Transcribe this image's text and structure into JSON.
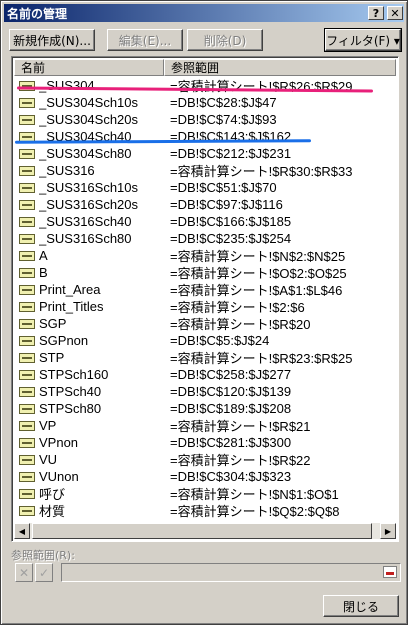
{
  "window": {
    "title": "名前の管理",
    "help_label": "?",
    "close_label": "✕"
  },
  "toolbar": {
    "new_label": "新規作成(N)...",
    "edit_label": "編集(E)...",
    "delete_label": "削除(D)",
    "filter_label": "フィルタ(F) ▾"
  },
  "list": {
    "headers": [
      "名前",
      "参照範囲"
    ],
    "rows": [
      {
        "name": "_SUS304",
        "ref": "=容積計算シート!$R$26:$R$29"
      },
      {
        "name": "_SUS304Sch10s",
        "ref": "=DB!$C$28:$J$47"
      },
      {
        "name": "_SUS304Sch20s",
        "ref": "=DB!$C$74:$J$93"
      },
      {
        "name": "_SUS304Sch40",
        "ref": "=DB!$C$143:$J$162"
      },
      {
        "name": "_SUS304Sch80",
        "ref": "=DB!$C$212:$J$231"
      },
      {
        "name": "_SUS316",
        "ref": "=容積計算シート!$R$30:$R$33"
      },
      {
        "name": "_SUS316Sch10s",
        "ref": "=DB!$C$51:$J$70"
      },
      {
        "name": "_SUS316Sch20s",
        "ref": "=DB!$C$97:$J$116"
      },
      {
        "name": "_SUS316Sch40",
        "ref": "=DB!$C$166:$J$185"
      },
      {
        "name": "_SUS316Sch80",
        "ref": "=DB!$C$235:$J$254"
      },
      {
        "name": "A",
        "ref": "=容積計算シート!$N$2:$N$25"
      },
      {
        "name": "B",
        "ref": "=容積計算シート!$O$2:$O$25"
      },
      {
        "name": "Print_Area",
        "ref": "=容積計算シート!$A$1:$L$46"
      },
      {
        "name": "Print_Titles",
        "ref": "=容積計算シート!$2:$6"
      },
      {
        "name": "SGP",
        "ref": "=容積計算シート!$R$20"
      },
      {
        "name": "SGPnon",
        "ref": "=DB!$C$5:$J$24"
      },
      {
        "name": "STP",
        "ref": "=容積計算シート!$R$23:$R$25"
      },
      {
        "name": "STPSch160",
        "ref": "=DB!$C$258:$J$277"
      },
      {
        "name": "STPSch40",
        "ref": "=DB!$C$120:$J$139"
      },
      {
        "name": "STPSch80",
        "ref": "=DB!$C$189:$J$208"
      },
      {
        "name": "VP",
        "ref": "=容積計算シート!$R$21"
      },
      {
        "name": "VPnon",
        "ref": "=DB!$C$281:$J$300"
      },
      {
        "name": "VU",
        "ref": "=容積計算シート!$R$22"
      },
      {
        "name": "VUnon",
        "ref": "=DB!$C$304:$J$323"
      },
      {
        "name": "呼び",
        "ref": "=容積計算シート!$N$1:$O$1"
      },
      {
        "name": "材質",
        "ref": "=容積計算シート!$Q$2:$Q$8"
      }
    ]
  },
  "annotations": {
    "red_color": "#e8207a",
    "blue_color": "#1a6fe8"
  },
  "footer": {
    "ref_label": "参照範囲(R):",
    "cancel_icon": "✕",
    "ok_icon": "✓",
    "close_label": "閉じる"
  }
}
